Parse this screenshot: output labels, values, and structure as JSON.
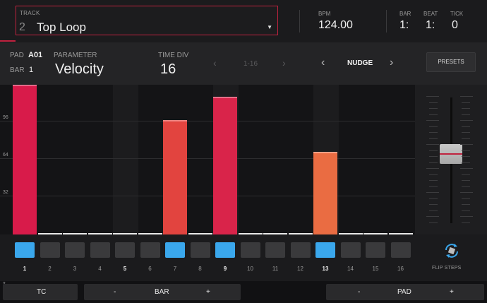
{
  "header": {
    "track_label": "TRACK",
    "track_number": "2",
    "track_name": "Top Loop",
    "bpm_label": "BPM",
    "bpm_value": "124.00",
    "bar_label": "BAR",
    "bar_value": "1:",
    "beat_label": "BEAT",
    "beat_value": "1:",
    "tick_label": "TICK",
    "tick_value": "0"
  },
  "params": {
    "pad_label": "PAD",
    "pad_value": "A01",
    "bar_label": "BAR",
    "bar_value": "1",
    "parameter_label": "PARAMETER",
    "parameter_value": "Velocity",
    "timediv_label": "TIME DIV",
    "timediv_value": "16",
    "range_label": "1-16",
    "nudge_label": "NUDGE",
    "presets_label": "PRESETS"
  },
  "graph": {
    "y_ticks": [
      "96",
      "64",
      "32"
    ],
    "y_max": 127,
    "bars": [
      {
        "step": 1,
        "value": 127,
        "color": "#d81b4a"
      },
      {
        "step": 7,
        "value": 97,
        "color": "#e2443f"
      },
      {
        "step": 9,
        "value": 117,
        "color": "#d9244a"
      },
      {
        "step": 13,
        "value": 70,
        "color": "#ea6c42"
      }
    ]
  },
  "slider": {
    "level_fraction": 0.55
  },
  "steps": {
    "numbers": [
      "1",
      "2",
      "3",
      "4",
      "5",
      "6",
      "7",
      "8",
      "9",
      "10",
      "11",
      "12",
      "13",
      "14",
      "15",
      "16"
    ],
    "active": [
      1,
      7,
      9,
      13
    ],
    "highlight_numbers": [
      1,
      5,
      9,
      13
    ],
    "flip_label": "FLIP STEPS"
  },
  "bottom": {
    "tc_label": "TC",
    "bar_label": "BAR",
    "pad_label": "PAD",
    "minus": "-",
    "plus": "+"
  },
  "colors": {
    "accent": "#c0223f",
    "step_on": "#3aa7ec"
  }
}
